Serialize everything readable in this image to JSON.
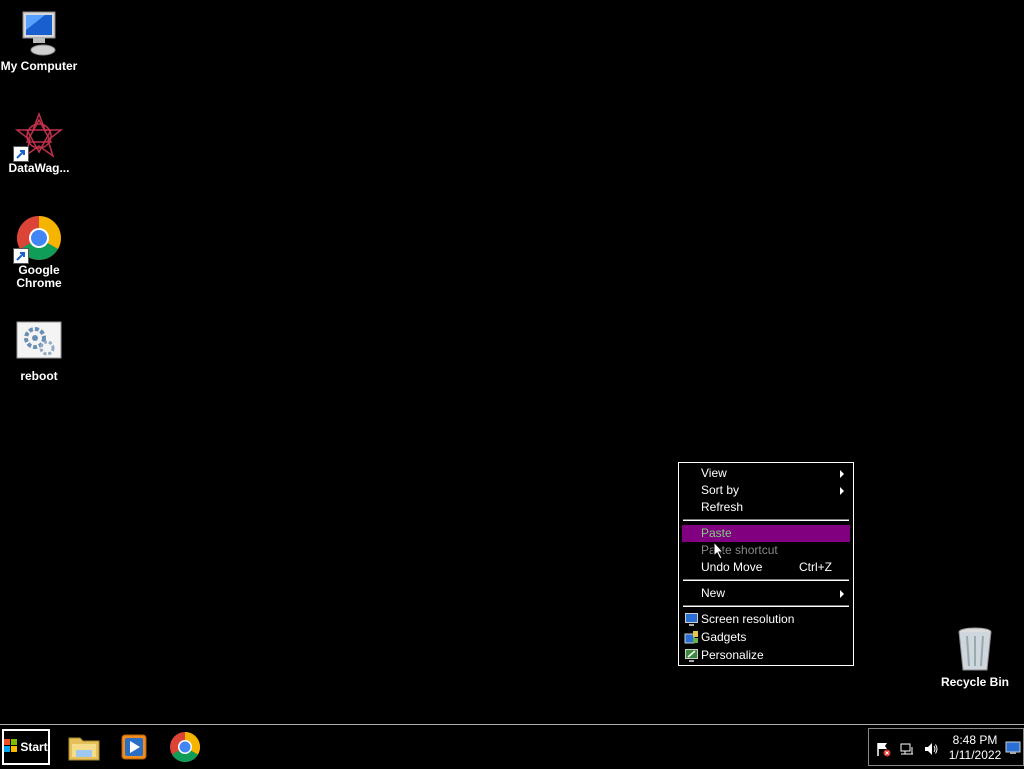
{
  "desktop": {
    "icons": [
      {
        "label": "My Computer"
      },
      {
        "label": "DataWag..."
      },
      {
        "label": "Google\nChrome"
      },
      {
        "label": "reboot"
      },
      {
        "label": "Recycle Bin"
      }
    ]
  },
  "context_menu": {
    "items": [
      {
        "label": "View",
        "submenu": true
      },
      {
        "label": "Sort by",
        "submenu": true
      },
      {
        "label": "Refresh"
      },
      {
        "label": "Paste",
        "highlighted": true
      },
      {
        "label": "Paste shortcut",
        "state": "disabled"
      },
      {
        "label": "Undo Move",
        "accelerator": "Ctrl+Z"
      },
      {
        "label": "New",
        "submenu": true
      },
      {
        "label": "Screen resolution",
        "icon": "screen-resolution-icon"
      },
      {
        "label": "Gadgets",
        "icon": "gadgets-icon"
      },
      {
        "label": "Personalize",
        "icon": "personalize-icon"
      }
    ],
    "highlight_color": "#800080"
  },
  "taskbar": {
    "start_label": "Start",
    "apps": [
      "file-explorer-icon",
      "media-player-icon",
      "chrome-icon"
    ],
    "clock": {
      "time": "8:48 PM",
      "date": "1/11/2022"
    }
  }
}
